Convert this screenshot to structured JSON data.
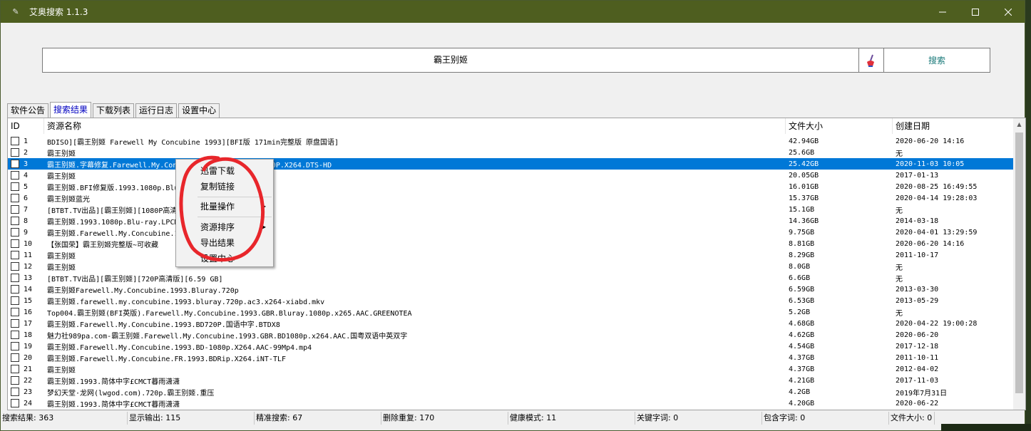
{
  "window": {
    "title": "艾奥搜索 1.1.3"
  },
  "search": {
    "query": "霸王别姬",
    "button": "搜索"
  },
  "tabs": [
    "软件公告",
    "搜索结果",
    "下载列表",
    "运行日志",
    "设置中心"
  ],
  "columns": {
    "id": "ID",
    "name": "资源名称",
    "size": "文件大小",
    "date": "创建日期"
  },
  "rows": [
    {
      "id": "1",
      "name": "BDISO][霸王别姬 Farewell My Concubine 1993][BFI版 171min完整版 原盘国语]",
      "size": "42.94GB",
      "date": "2020-06-20 14:16"
    },
    {
      "id": "2",
      "name": "霸王别姬",
      "size": "25.6GB",
      "date": "无"
    },
    {
      "id": "3",
      "name": "霸王别姬.字幕修复.Farewell.My.Concubine.1993.BluRay.1080P.X264.DTS-HD",
      "size": "25.42GB",
      "date": "2020-11-03 10:05"
    },
    {
      "id": "4",
      "name": "霸王别姬",
      "size": "20.05GB",
      "date": "2017-01-13"
    },
    {
      "id": "5",
      "name": "霸王别姬.BFI修复版.1993.1080p.BluRay",
      "size": "16.01GB",
      "date": "2020-08-25 16:49:55"
    },
    {
      "id": "6",
      "name": "霸王别姬蓝光",
      "size": "15.37GB",
      "date": "2020-04-14 19:28:03"
    },
    {
      "id": "7",
      "name": "[BTBT.TV出品][霸王别姬][1080P高清版]",
      "size": "15.1GB",
      "date": "无"
    },
    {
      "id": "8",
      "name": "霸王别姬.1993.1080p.Blu-ray.LPCM.x264-BTDX8",
      "size": "14.36GB",
      "date": "2014-03-18"
    },
    {
      "id": "9",
      "name": "霸王别姬.Farewell.My.Concubine.1993.BD1080P.X264.BTDX8",
      "size": "9.75GB",
      "date": "2020-04-01 13:29:59"
    },
    {
      "id": "10",
      "name": "【张国荣】霸王别姬完整版~可收藏",
      "size": "8.81GB",
      "date": "2020-06-20 14:16"
    },
    {
      "id": "11",
      "name": "霸王别姬",
      "size": "8.29GB",
      "date": "2011-10-17"
    },
    {
      "id": "12",
      "name": "霸王别姬",
      "size": "8.0GB",
      "date": "无"
    },
    {
      "id": "13",
      "name": "[BTBT.TV出品][霸王别姬][720P高清版][6.59 GB]",
      "size": "6.6GB",
      "date": "无"
    },
    {
      "id": "14",
      "name": "霸王别姬Farewell.My.Concubine.1993.Bluray.720p",
      "size": "6.59GB",
      "date": "2013-03-30"
    },
    {
      "id": "15",
      "name": "霸王别姬.farewell.my.concubine.1993.bluray.720p.ac3.x264-xiabd.mkv",
      "size": "6.53GB",
      "date": "2013-05-29"
    },
    {
      "id": "16",
      "name": "Top004.霸王别姬(BFI英版).Farewell.My.Concubine.1993.GBR.Bluray.1080p.x265.AAC.GREENOTEA",
      "size": "5.2GB",
      "date": "无"
    },
    {
      "id": "17",
      "name": "霸王别姬.Farewell.My.Concubine.1993.BD720P.国语中字.BTDX8",
      "size": "4.68GB",
      "date": "2020-04-22 19:00:28"
    },
    {
      "id": "18",
      "name": "魅力社989pa.com-霸王别姬.Farewell.My.Concubine.1993.GBR.BD1080p.x264.AAC.国粤双语中英双字",
      "size": "4.62GB",
      "date": "2020-06-20"
    },
    {
      "id": "19",
      "name": "霸王别姬.Farewell.My.Concubine.1993.BD-1080p.X264.AAC-99Mp4.mp4",
      "size": "4.54GB",
      "date": "2017-12-18"
    },
    {
      "id": "20",
      "name": "霸王别姬.Farewell.My.Concubine.FR.1993.BDRip.X264.iNT-TLF",
      "size": "4.37GB",
      "date": "2011-10-11"
    },
    {
      "id": "21",
      "name": "霸王别姬",
      "size": "4.37GB",
      "date": "2012-04-02"
    },
    {
      "id": "22",
      "name": "霸王别姬.1993.简体中字£CMCT暮雨潇潇",
      "size": "4.21GB",
      "date": "2017-11-03"
    },
    {
      "id": "23",
      "name": "梦幻天堂·龙网(lwgod.com).720p.霸王别姬.重压",
      "size": "4.2GB",
      "date": "2019年7月31日"
    },
    {
      "id": "24",
      "name": "霸王别姬.1993.简体中字£CMCT暮雨潇潇",
      "size": "4.20GB",
      "date": "2020-06-22"
    }
  ],
  "selected_row": 3,
  "context_menu": [
    "迅雷下载",
    "复制链接",
    "批量操作",
    "资源排序",
    "导出结果",
    "设置中心"
  ],
  "status": [
    "搜索结果: 363",
    "显示输出: 115",
    "精准搜索: 67",
    "删除重复: 170",
    "健康模式: 11",
    "关键字词: 0",
    "包含字词: 0",
    "文件大小: 0"
  ],
  "colors": {
    "titlebar": "#4e5e1f",
    "selection": "#0078d7",
    "annotation": "#e8262b",
    "search_button_text": "#1a7a7a"
  }
}
